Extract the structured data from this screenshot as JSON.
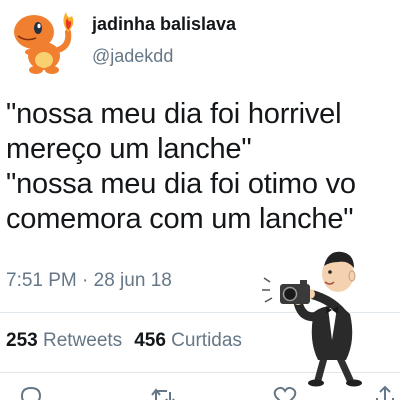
{
  "tweet": {
    "display_name": "jadinha balislava",
    "username": "@jadekdd",
    "text_lines": [
      "\"nossa meu dia foi horrivel",
      "mereço um lanche\"",
      "\"nossa meu dia foi otimo vo",
      "comemora com um lanche\""
    ],
    "timestamp": "7:51 PM · 28 jun 18",
    "retweets_count": "253",
    "retweets_label": "Retweets",
    "likes_count": "456",
    "likes_label": "Curtidas"
  },
  "icons": {
    "avatar": "charmander-avatar",
    "actions": [
      "reply-icon",
      "retweet-icon",
      "like-icon",
      "share-icon"
    ],
    "overlay": "photographer-cartoon"
  },
  "colors": {
    "text_primary": "#14171a",
    "text_secondary": "#657786",
    "divider": "#e1e8ed",
    "avatar_orange": "#f08030"
  }
}
